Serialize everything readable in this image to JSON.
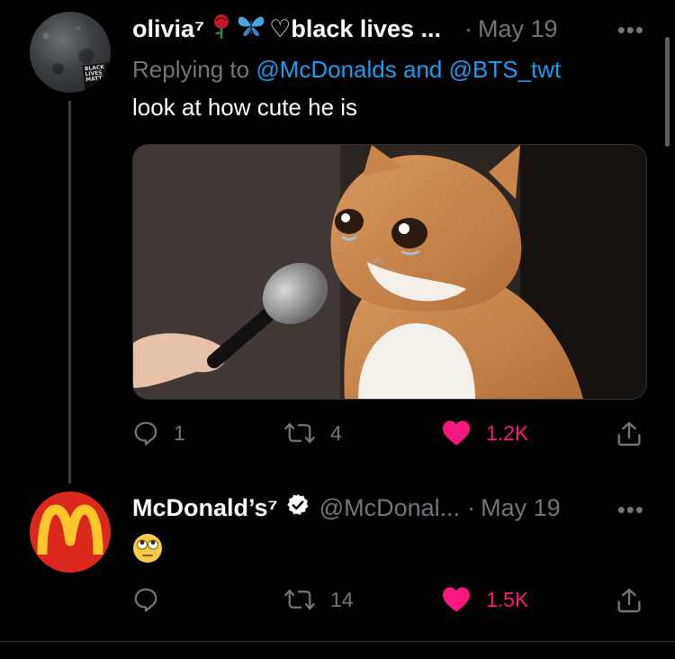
{
  "tweets": [
    {
      "name": "olivia⁷",
      "name_suffix": "♡black lives ...",
      "dot": "·",
      "date": "May 19",
      "more": "•••",
      "reply_label": "Replying to",
      "reply_to": "@McDonalds and @BTS_twt",
      "text": "look at how cute he is",
      "avatar_sign_text": "BLACK LIVES MATTER",
      "actions": {
        "replies": "1",
        "retweets": "4",
        "likes": "1.2K"
      }
    },
    {
      "name": "McDonald’s⁷",
      "handle": "@McDonal...",
      "dot": "·",
      "date": "May 19",
      "more": "•••",
      "actions": {
        "replies": "",
        "retweets": "14",
        "likes": "1.5K"
      }
    }
  ],
  "colors": {
    "background": "#000000",
    "muted": "#71767b",
    "link": "#1d9bf0",
    "like": "#f91880",
    "mcd_red": "#da291c",
    "mcd_yellow": "#ffc72c"
  },
  "icons": [
    "reply-icon",
    "retweet-icon",
    "like-icon",
    "share-icon",
    "rose-icon",
    "butterfly-icon",
    "verified-icon",
    "eye-roll-emoji"
  ]
}
